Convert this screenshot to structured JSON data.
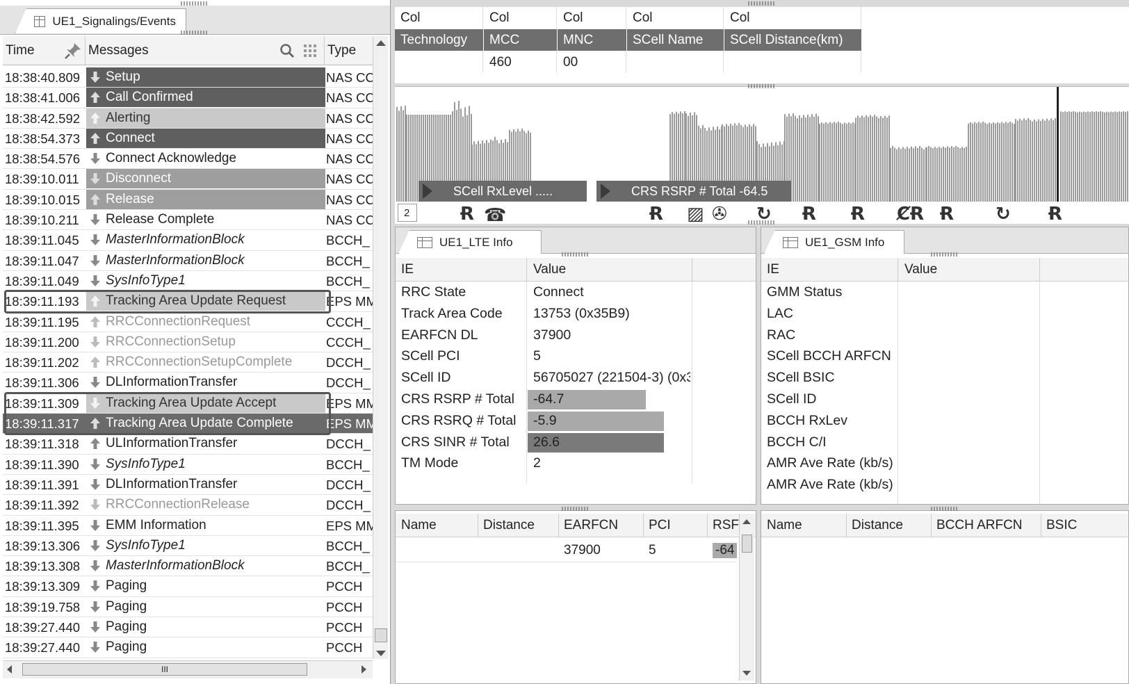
{
  "left_panel": {
    "tab_title": "UE1_Signalings/Events",
    "columns": {
      "time": "Time",
      "messages": "Messages",
      "type": "Type"
    },
    "rows": [
      {
        "time": "18:38:40.809",
        "msg": "Setup",
        "type": "NAS CC",
        "dir": "down",
        "style": "dark"
      },
      {
        "time": "18:38:41.006",
        "msg": "Call Confirmed",
        "type": "NAS CC",
        "dir": "up",
        "style": "dark"
      },
      {
        "time": "18:38:42.592",
        "msg": "Alerting",
        "type": "NAS CC",
        "dir": "up",
        "style": "light"
      },
      {
        "time": "18:38:54.373",
        "msg": "Connect",
        "type": "NAS CC",
        "dir": "up",
        "style": "dark"
      },
      {
        "time": "18:38:54.576",
        "msg": "Connect Acknowledge",
        "type": "NAS CC",
        "dir": "down",
        "style": "plain"
      },
      {
        "time": "18:39:10.011",
        "msg": "Disconnect",
        "type": "NAS CC",
        "dir": "down",
        "style": "mid"
      },
      {
        "time": "18:39:10.015",
        "msg": "Release",
        "type": "NAS CC",
        "dir": "up",
        "style": "mid"
      },
      {
        "time": "18:39:10.211",
        "msg": "Release Complete",
        "type": "NAS CC",
        "dir": "down",
        "style": "plain"
      },
      {
        "time": "18:39:11.045",
        "msg": "MasterInformationBlock",
        "type": "BCCH_",
        "dir": "down",
        "style": "ital"
      },
      {
        "time": "18:39:11.047",
        "msg": "MasterInformationBlock",
        "type": "BCCH_",
        "dir": "down",
        "style": "ital"
      },
      {
        "time": "18:39:11.049",
        "msg": "SysInfoType1",
        "type": "BCCH_",
        "dir": "down",
        "style": "ital"
      },
      {
        "time": "18:39:11.193",
        "msg": "Tracking Area Update Request",
        "type": "EPS MM",
        "dir": "up",
        "style": "light"
      },
      {
        "time": "18:39:11.195",
        "msg": "RRCConnectionRequest",
        "type": "CCCH_",
        "dir": "up",
        "style": "gray"
      },
      {
        "time": "18:39:11.200",
        "msg": "RRCConnectionSetup",
        "type": "CCCH_",
        "dir": "down",
        "style": "gray"
      },
      {
        "time": "18:39:11.202",
        "msg": "RRCConnectionSetupComplete",
        "type": "DCCH_",
        "dir": "up",
        "style": "gray"
      },
      {
        "time": "18:39:11.306",
        "msg": "DLInformationTransfer",
        "type": "DCCH_",
        "dir": "down",
        "style": "plain"
      },
      {
        "time": "18:39:11.309",
        "msg": "Tracking Area Update Accept",
        "type": "EPS MM",
        "dir": "down",
        "style": "light"
      },
      {
        "time": "18:39:11.317",
        "msg": "Tracking Area Update Complete",
        "type": "EPS MM",
        "dir": "up",
        "style": "sel"
      },
      {
        "time": "18:39:11.318",
        "msg": "ULInformationTransfer",
        "type": "DCCH_",
        "dir": "up",
        "style": "plain"
      },
      {
        "time": "18:39:11.390",
        "msg": "SysInfoType1",
        "type": "BCCH_",
        "dir": "down",
        "style": "ital"
      },
      {
        "time": "18:39:11.391",
        "msg": "DLInformationTransfer",
        "type": "DCCH_",
        "dir": "down",
        "style": "plain"
      },
      {
        "time": "18:39:11.392",
        "msg": "RRCConnectionRelease",
        "type": "DCCH_",
        "dir": "down",
        "style": "gray"
      },
      {
        "time": "18:39:11.395",
        "msg": "EMM Information",
        "type": "EPS MM",
        "dir": "down",
        "style": "plain"
      },
      {
        "time": "18:39:13.306",
        "msg": "SysInfoType1",
        "type": "BCCH_",
        "dir": "down",
        "style": "ital"
      },
      {
        "time": "18:39:13.308",
        "msg": "MasterInformationBlock",
        "type": "BCCH_",
        "dir": "down",
        "style": "ital"
      },
      {
        "time": "18:39:13.309",
        "msg": "Paging",
        "type": "PCCH",
        "dir": "down",
        "style": "plain"
      },
      {
        "time": "18:39:19.758",
        "msg": "Paging",
        "type": "PCCH",
        "dir": "down",
        "style": "plain"
      },
      {
        "time": "18:39:27.440",
        "msg": "Paging",
        "type": "PCCH",
        "dir": "down",
        "style": "plain"
      },
      {
        "time": "18:39:27.440",
        "msg": "Paging",
        "type": "PCCH",
        "dir": "down",
        "style": "plain"
      }
    ],
    "hscroll_thumb": "III"
  },
  "top_grid": {
    "row1": [
      "Col",
      "Col",
      "Col",
      "Col",
      "Col"
    ],
    "row2": [
      "Technology",
      "MCC",
      "MNC",
      "SCell Name",
      "SCell Distance(km)"
    ],
    "row3": [
      "",
      "460",
      "00",
      "",
      ""
    ]
  },
  "graph": {
    "label_left": "SCell RxLevel .....",
    "label_right": "CRS RSRP # Total -64.5",
    "count": "2"
  },
  "lte_info": {
    "tab_title": "UE1_LTE Info",
    "header": {
      "ie": "IE",
      "value": "Value"
    },
    "rows": [
      {
        "ie": "RRC State",
        "value": "Connect"
      },
      {
        "ie": "Track Area Code",
        "value": "13753 (0x35B9)"
      },
      {
        "ie": "EARFCN DL",
        "value": "37900"
      },
      {
        "ie": "SCell PCI",
        "value": "5"
      },
      {
        "ie": "SCell ID",
        "value": "56705027 (221504-3) (0x3"
      },
      {
        "ie": "CRS RSRP # Total",
        "value": "-64.7"
      },
      {
        "ie": "CRS RSRQ # Total",
        "value": "-5.9"
      },
      {
        "ie": "CRS SINR # Total",
        "value": "26.6"
      },
      {
        "ie": "TM Mode",
        "value": "2"
      }
    ],
    "neighbor_header": [
      "Name",
      "Distance",
      "EARFCN",
      "PCI",
      "RSF"
    ],
    "neighbor_row": [
      "",
      "",
      "37900",
      "5",
      "-64"
    ]
  },
  "gsm_info": {
    "tab_title": "UE1_GSM Info",
    "header": {
      "ie": "IE",
      "value": "Value"
    },
    "rows": [
      "GMM Status",
      "LAC",
      "RAC",
      "SCell BCCH ARFCN",
      "SCell BSIC",
      "SCell ID",
      "BCCH RxLev",
      "BCCH C/I",
      "AMR Ave Rate (kb/s)",
      "AMR Ave Rate (kb/s)"
    ],
    "neighbor_header": [
      "Name",
      "Distance",
      "BCCH ARFCN",
      "BSIC"
    ]
  },
  "colors": {
    "dark_row": "#5f5f5f",
    "mid_row": "#9e9e9e",
    "light_row": "#c9c9c9",
    "header_gray": "#6e6e6e"
  }
}
